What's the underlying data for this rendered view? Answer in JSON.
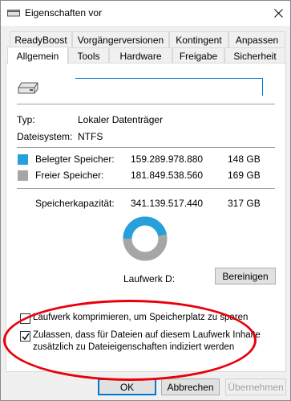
{
  "window": {
    "title": "Eigenschaften vor"
  },
  "tabs_row1": [
    {
      "label": "ReadyBoost"
    },
    {
      "label": "Vorgängerversionen"
    },
    {
      "label": "Kontingent"
    },
    {
      "label": "Anpassen"
    }
  ],
  "tabs_row2": [
    {
      "label": "Allgemein",
      "active": true
    },
    {
      "label": "Tools"
    },
    {
      "label": "Hardware"
    },
    {
      "label": "Freigabe"
    },
    {
      "label": "Sicherheit"
    }
  ],
  "general": {
    "drive_name_value": "",
    "type_label": "Typ:",
    "type_value": "Lokaler Datenträger",
    "fs_label": "Dateisystem:",
    "fs_value": "NTFS",
    "used_label": "Belegter Speicher:",
    "used_bytes": "159.289.978.880",
    "used_size": "148 GB",
    "free_label": "Freier Speicher:",
    "free_bytes": "181.849.538.560",
    "free_size": "169 GB",
    "capacity_label": "Speicherkapazität:",
    "capacity_bytes": "341.139.517.440",
    "capacity_size": "317 GB",
    "drive_label": "Laufwerk D:",
    "cleanup_button": "Bereinigen",
    "used_color": "#26a0da",
    "free_color": "#a6a6a6",
    "used_fraction": 0.467
  },
  "options": {
    "compress_label": "Laufwerk komprimieren, um Speicherplatz zu sparen",
    "compress_checked": false,
    "index_label_line1": "Zulassen, dass für Dateien auf diesem Laufwerk Inhalte",
    "index_label_line2": "zusätzlich zu Dateieigenschaften indiziert werden",
    "index_checked": true
  },
  "footer": {
    "ok": "OK",
    "cancel": "Abbrechen",
    "apply": "Übernehmen"
  },
  "annotation": {
    "color": "#e8000b"
  }
}
